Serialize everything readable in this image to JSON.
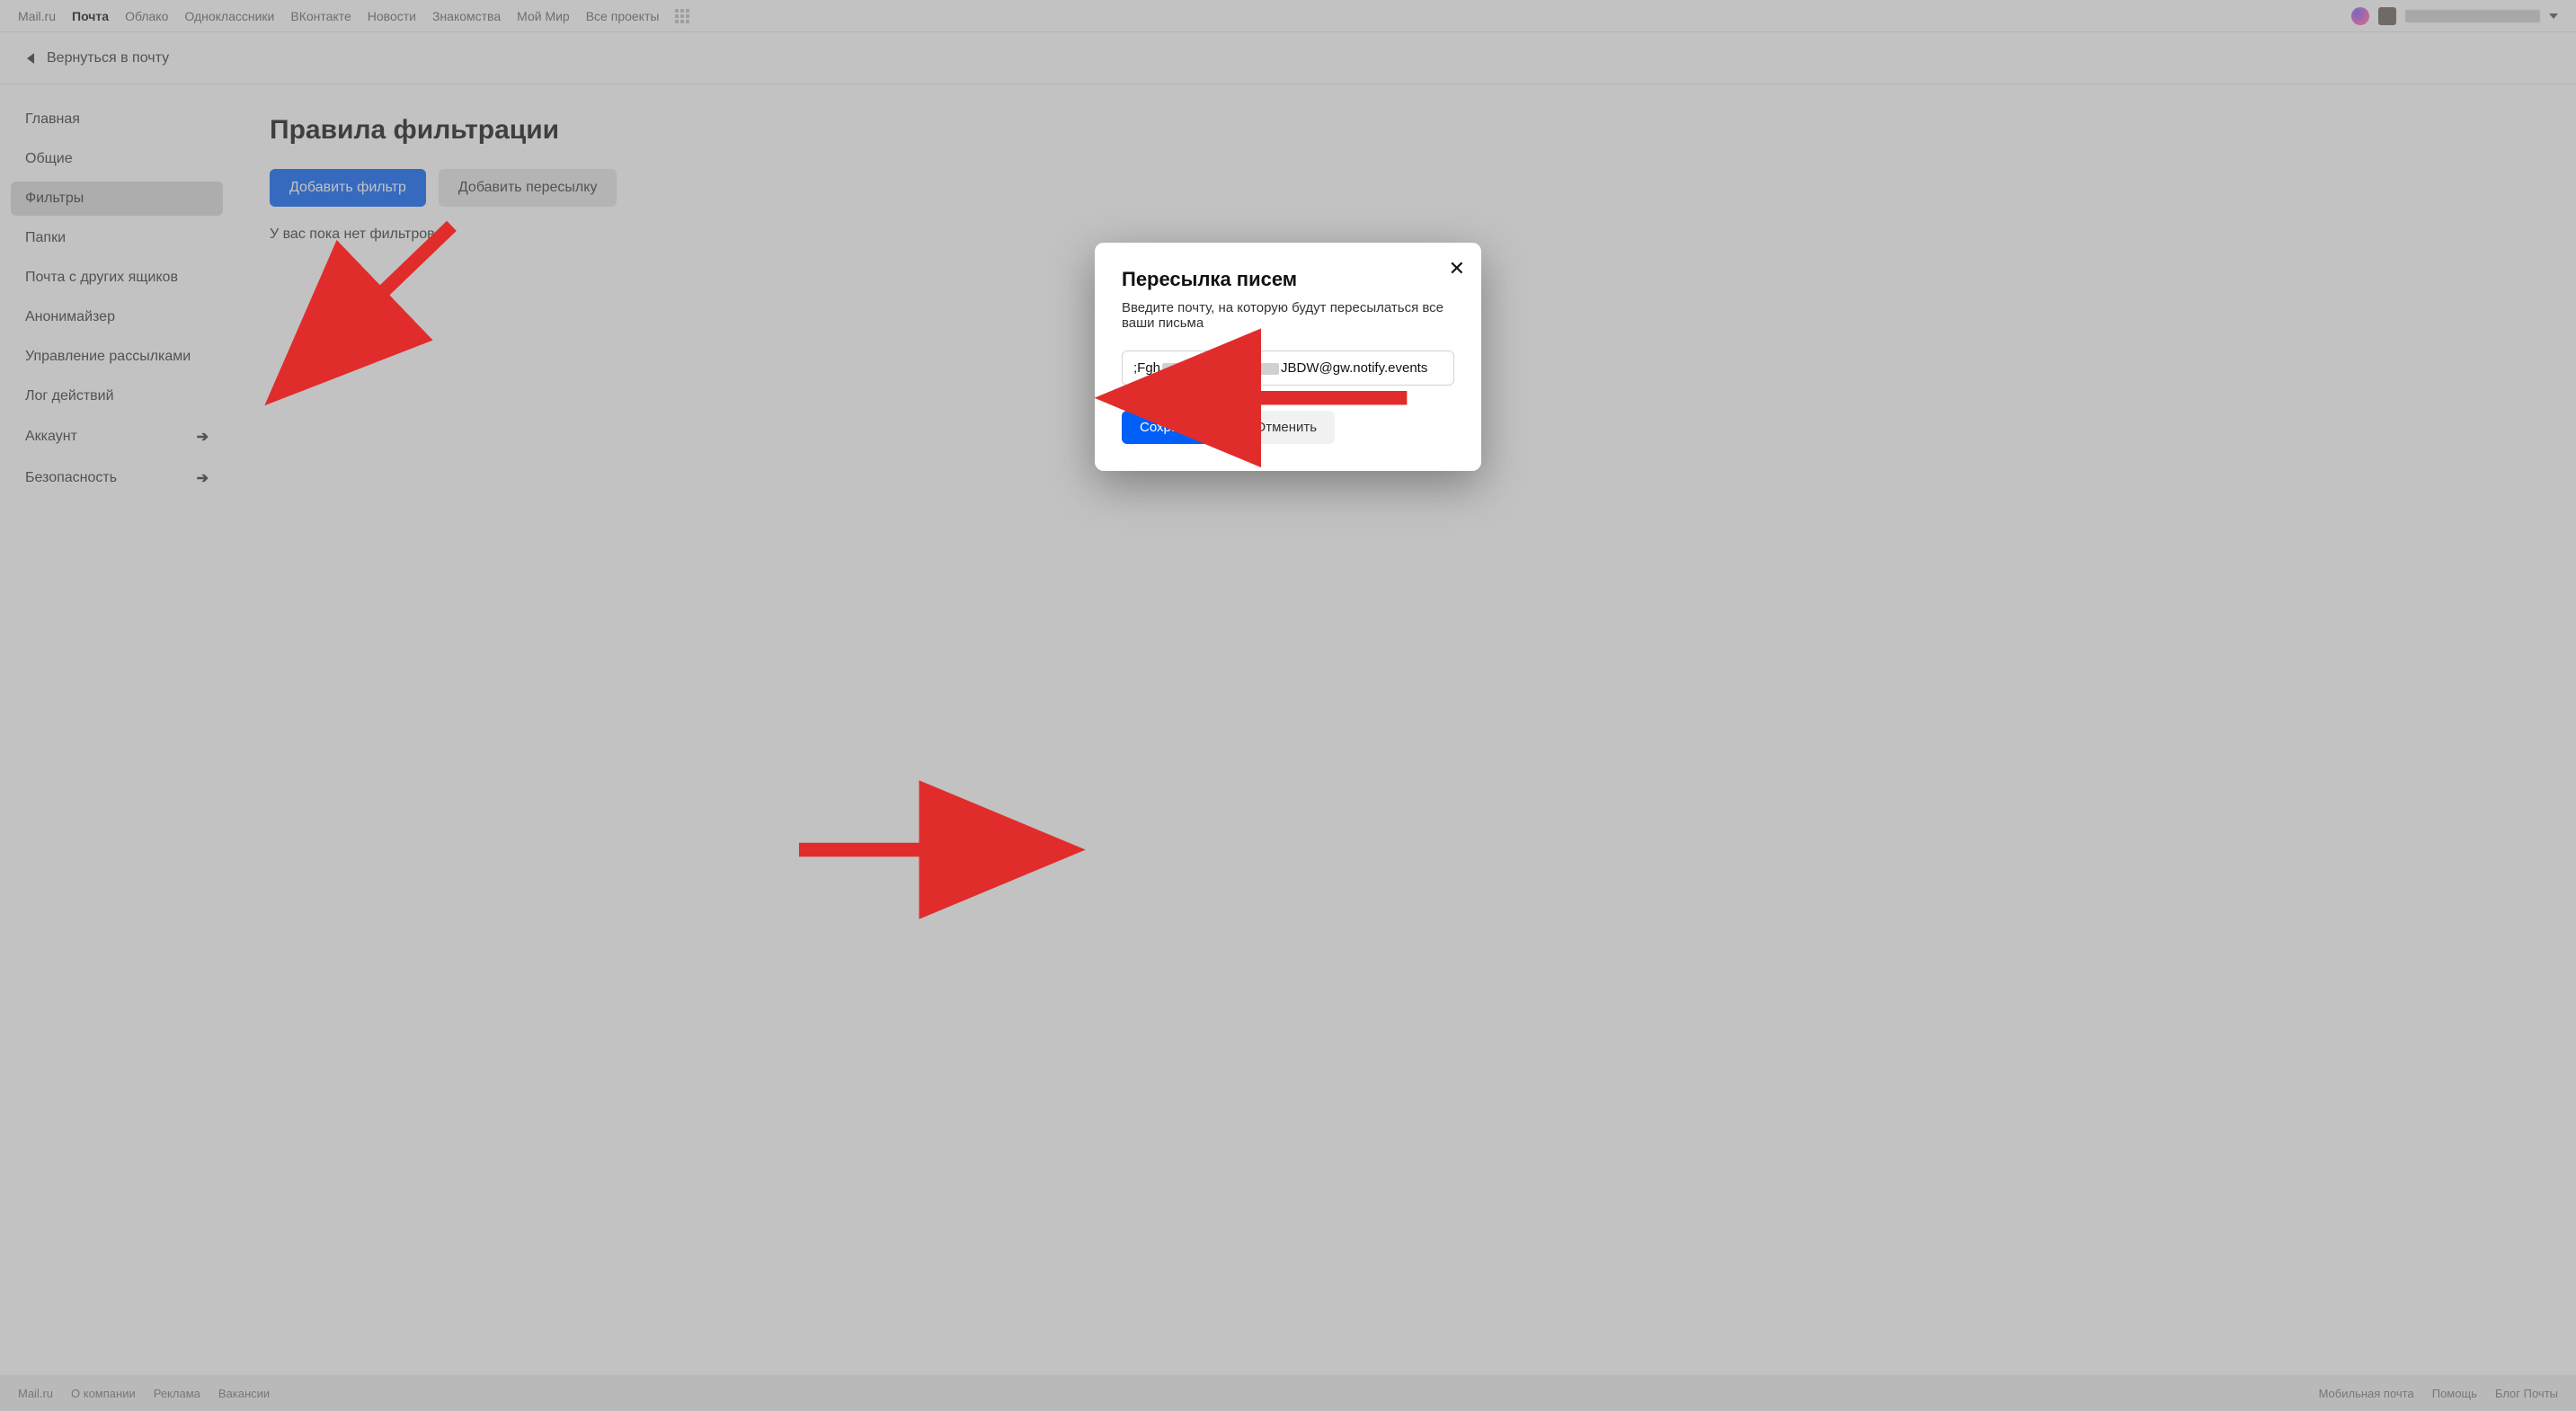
{
  "topnav": {
    "items": [
      {
        "label": "Mail.ru",
        "active": false
      },
      {
        "label": "Почта",
        "active": true
      },
      {
        "label": "Облако",
        "active": false
      },
      {
        "label": "Одноклассники",
        "active": false
      },
      {
        "label": "ВКонтакте",
        "active": false
      },
      {
        "label": "Новости",
        "active": false
      },
      {
        "label": "Знакомства",
        "active": false
      },
      {
        "label": "Мой Мир",
        "active": false
      },
      {
        "label": "Все проекты",
        "active": false
      }
    ]
  },
  "subheader": {
    "back_label": "Вернуться в почту"
  },
  "sidebar": {
    "items": [
      {
        "label": "Главная",
        "selected": false,
        "arrow": false
      },
      {
        "label": "Общие",
        "selected": false,
        "arrow": false
      },
      {
        "label": "Фильтры",
        "selected": true,
        "arrow": false
      },
      {
        "label": "Папки",
        "selected": false,
        "arrow": false
      },
      {
        "label": "Почта с других ящиков",
        "selected": false,
        "arrow": false
      },
      {
        "label": "Анонимайзер",
        "selected": false,
        "arrow": false
      },
      {
        "label": "Управление рассылками",
        "selected": false,
        "arrow": false
      },
      {
        "label": "Лог действий",
        "selected": false,
        "arrow": false
      },
      {
        "label": "Аккаунт",
        "selected": false,
        "arrow": true
      },
      {
        "label": "Безопасность",
        "selected": false,
        "arrow": true
      }
    ]
  },
  "page": {
    "title": "Правила фильтрации",
    "add_filter_label": "Добавить фильтр",
    "add_forward_label": "Добавить пересылку",
    "empty_text": "У вас пока нет фильтров и"
  },
  "modal": {
    "title": "Пересылка писем",
    "description": "Введите почту, на которую будут пересылаться все ваши письма",
    "input_prefix": ";Fgh",
    "input_suffix": "JBDW@gw.notify.events",
    "save_label": "Сохранить",
    "cancel_label": "Отменить"
  },
  "footer": {
    "left": [
      {
        "label": "Mail.ru"
      },
      {
        "label": "О компании"
      },
      {
        "label": "Реклама"
      },
      {
        "label": "Вакансии"
      }
    ],
    "right": [
      {
        "label": "Мобильная почта"
      },
      {
        "label": "Помощь"
      },
      {
        "label": "Блог Почты"
      }
    ]
  }
}
